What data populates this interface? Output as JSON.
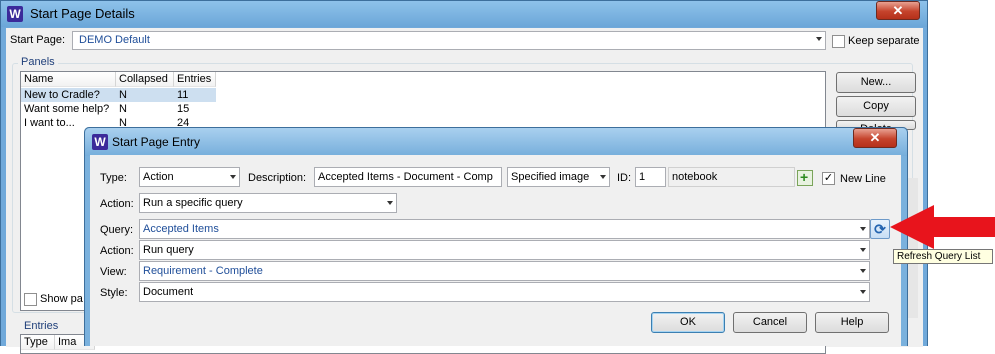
{
  "outer_window": {
    "icon_letter": "W",
    "title": "Start Page Details",
    "close_glyph": "✕",
    "start_page_label": "Start Page:",
    "start_page_value": "DEMO Default",
    "keep_separate_label": "Keep separate",
    "panels_legend": "Panels",
    "panels_columns": [
      "Name",
      "Collapsed",
      "Entries"
    ],
    "panels_rows": [
      {
        "name": "New to Cradle?",
        "collapsed": "N",
        "entries": "11"
      },
      {
        "name": "Want some help?",
        "collapsed": "N",
        "entries": "15"
      },
      {
        "name": "I want to...",
        "collapsed": "N",
        "entries": "24"
      }
    ],
    "buttons": {
      "new": "New...",
      "copy": "Copy",
      "delete": "Delete"
    },
    "show_panel_label": "Show pa",
    "entries_legend": "Entries",
    "entries_columns": [
      "Type",
      "Ima"
    ]
  },
  "dialog": {
    "icon_letter": "W",
    "title": "Start Page Entry",
    "close_glyph": "✕",
    "type_label": "Type:",
    "type_value": "Action",
    "description_label": "Description:",
    "description_value": "Accepted Items - Document - Comp",
    "image_mode_value": "Specified image",
    "id_label": "ID:",
    "id_value": "1",
    "image_name_value": "notebook",
    "new_line_label": "New Line",
    "new_line_checked": "✓",
    "action_label": "Action:",
    "action_value": "Run a specific query",
    "query_label": "Query:",
    "query_value": "Accepted Items",
    "query_action_label": "Action:",
    "query_action_value": "Run query",
    "view_label": "View:",
    "view_value": "Requirement - Complete",
    "style_label": "Style:",
    "style_value": "Document",
    "refresh_glyph": "⟳",
    "buttons": {
      "ok": "OK",
      "cancel": "Cancel",
      "help": "Help"
    }
  },
  "tooltip": "Refresh Query List",
  "colors": {
    "arrow": "#e8141c",
    "value_text": "#1f4e99",
    "title_bar": "#7ab1dd"
  }
}
